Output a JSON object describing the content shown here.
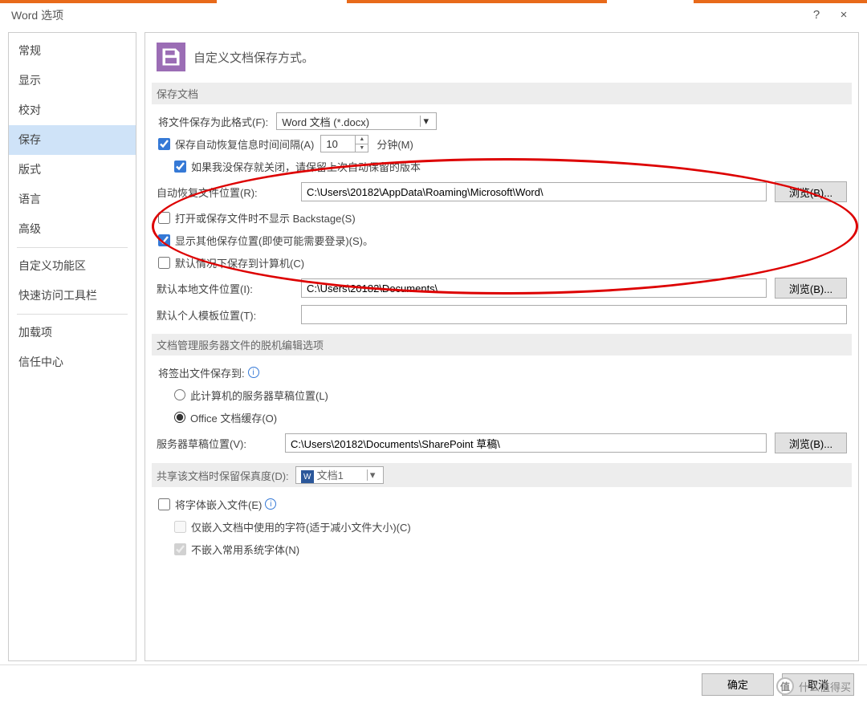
{
  "window": {
    "title": "Word 选项",
    "help": "?",
    "close": "×"
  },
  "sidebar": {
    "items": [
      {
        "label": "常规"
      },
      {
        "label": "显示"
      },
      {
        "label": "校对"
      },
      {
        "label": "保存",
        "selected": true
      },
      {
        "label": "版式"
      },
      {
        "label": "语言"
      },
      {
        "label": "高级"
      }
    ],
    "items2": [
      {
        "label": "自定义功能区"
      },
      {
        "label": "快速访问工具栏"
      }
    ],
    "items3": [
      {
        "label": "加载项"
      },
      {
        "label": "信任中心"
      }
    ]
  },
  "main": {
    "heading": "自定义文档保存方式。",
    "grp1_title": "保存文档",
    "format_label": "将文件保存为此格式(F):",
    "format_value": "Word 文档 (*.docx)",
    "autosave_chk": "保存自动恢复信息时间间隔(A)",
    "autosave_value": "10",
    "autosave_unit": "分钟(M)",
    "keeplast_chk": "如果我没保存就关闭，请保留上次自动保留的版本",
    "autorecover_label": "自动恢复文件位置(R):",
    "autorecover_path": "C:\\Users\\20182\\AppData\\Roaming\\Microsoft\\Word\\",
    "browse": "浏览(B)...",
    "backstage_chk": "打开或保存文件时不显示 Backstage(S)",
    "showother_chk": "显示其他保存位置(即使可能需要登录)(S)。",
    "defaultlocal_chk": "默认情况下保存到计算机(C)",
    "localpath_label": "默认本地文件位置(I):",
    "localpath": "C:\\Users\\20182\\Documents\\",
    "tmplpath_label": "默认个人模板位置(T):",
    "tmplpath": "",
    "grp2_title": "文档管理服务器文件的脱机编辑选项",
    "checkout_label": "将签出文件保存到:",
    "radio1": "此计算机的服务器草稿位置(L)",
    "radio2": "Office 文档缓存(O)",
    "draftloc_label": "服务器草稿位置(V):",
    "draftloc_path": "C:\\Users\\20182\\Documents\\SharePoint 草稿\\",
    "grp3_title": "共享该文档时保留保真度(D):",
    "grp3_doc": "文档1",
    "embed_chk": "将字体嵌入文件(E)",
    "embed_sub1": "仅嵌入文档中使用的字符(适于减小文件大小)(C)",
    "embed_sub2": "不嵌入常用系统字体(N)"
  },
  "footer": {
    "ok": "确定",
    "cancel": "取消"
  },
  "watermark": {
    "t1": "什么值得买"
  }
}
